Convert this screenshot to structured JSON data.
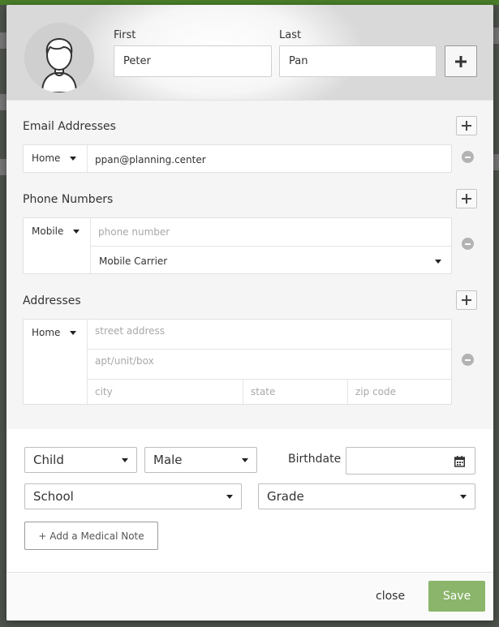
{
  "name": {
    "first_label": "First",
    "first_value": "Peter",
    "last_label": "Last",
    "last_value": "Pan"
  },
  "email": {
    "title": "Email Addresses",
    "type": "Home",
    "value": "ppan@planning.center"
  },
  "phone": {
    "title": "Phone Numbers",
    "type": "Mobile",
    "placeholder": "phone number",
    "carrier": "Mobile Carrier"
  },
  "address": {
    "title": "Addresses",
    "type": "Home",
    "street_placeholder": "street address",
    "apt_placeholder": "apt/unit/box",
    "city_placeholder": "city",
    "state_placeholder": "state",
    "zip_placeholder": "zip code"
  },
  "details": {
    "role": "Child",
    "gender": "Male",
    "birthdate_label": "Birthdate",
    "school": "School",
    "grade": "Grade",
    "medical_note_button": "+ Add a Medical Note"
  },
  "footer": {
    "close_label": "close",
    "save_label": "Save"
  },
  "colors": {
    "save_green": "#8bb56b",
    "backdrop_green": "#4a7d2a"
  },
  "icons": [
    "person-silhouette-icon",
    "plus-icon",
    "minus-circle-icon",
    "chevron-down-icon",
    "calendar-icon"
  ]
}
